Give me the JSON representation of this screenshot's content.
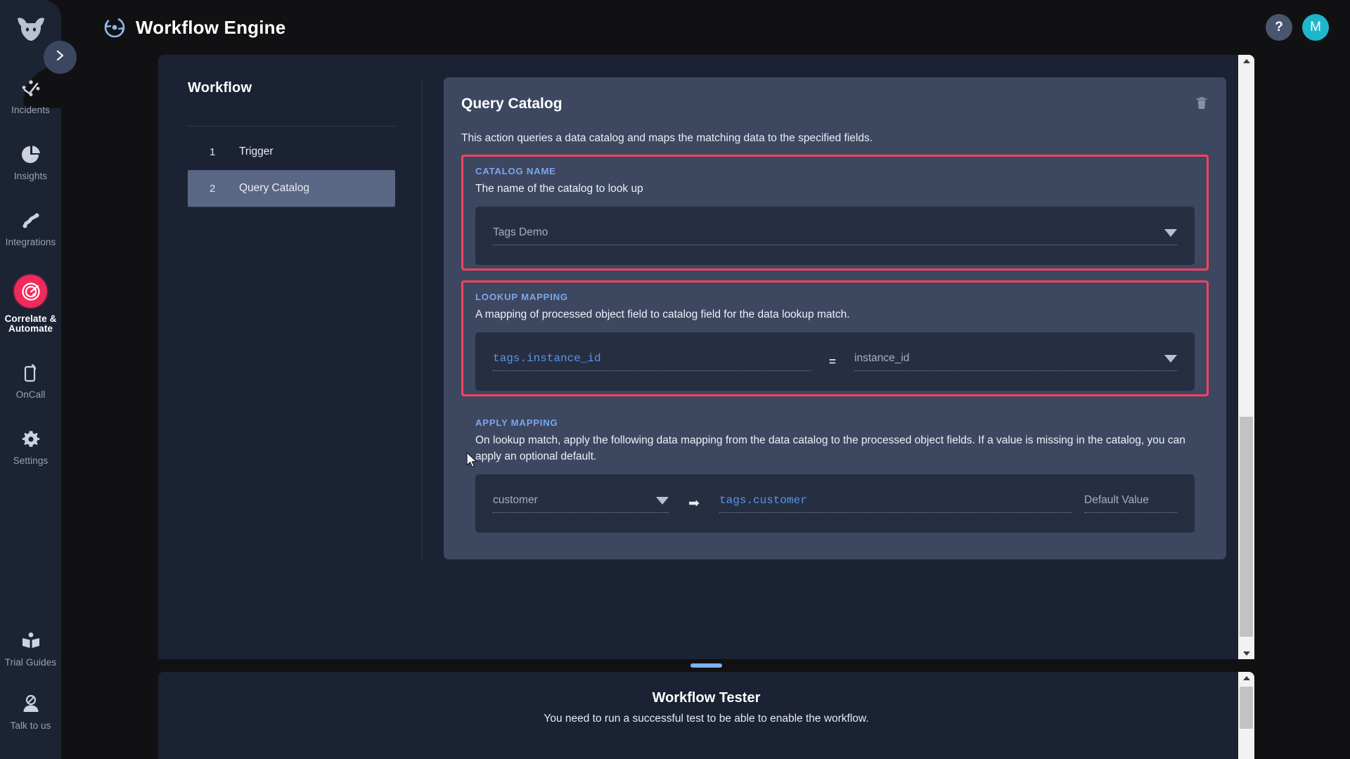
{
  "app": {
    "title": "Workflow Engine",
    "title_icon": "workflow-sync-icon",
    "logo_icon": "bull-head-logo",
    "collapse_icon": "chevron-right-icon",
    "help_label": "?",
    "avatar_label": "M"
  },
  "sidebar": {
    "items": [
      {
        "label": "Incidents",
        "icon": "incidents-nodes-icon",
        "active": false
      },
      {
        "label": "Insights",
        "icon": "pie-chart-icon",
        "active": false
      },
      {
        "label": "Integrations",
        "icon": "integrations-link-icon",
        "active": false
      },
      {
        "label": "Correlate & Automate",
        "icon": "target-radar-icon",
        "active": true
      },
      {
        "label": "OnCall",
        "icon": "mobile-phone-icon",
        "active": false
      },
      {
        "label": "Settings",
        "icon": "gear-icon",
        "active": false
      }
    ],
    "bottom_items": [
      {
        "label": "Trial Guides",
        "icon": "open-book-icon"
      },
      {
        "label": "Talk to us",
        "icon": "support-person-icon"
      }
    ]
  },
  "workflow_panel": {
    "title": "Workflow",
    "steps": [
      {
        "number": "1",
        "name": "Trigger",
        "selected": false
      },
      {
        "number": "2",
        "name": "Query Catalog",
        "selected": true
      }
    ]
  },
  "action_card": {
    "title": "Query Catalog",
    "description": "This action queries a data catalog and maps the matching data to the specified fields.",
    "delete_icon": "trash-icon",
    "fields": [
      {
        "key": "catalog_name",
        "label": "CATALOG NAME",
        "description": "The name of the catalog to look up",
        "highlighted": true,
        "value": "Tags Demo",
        "dropdown_icon": "chevron-down-icon"
      },
      {
        "key": "lookup_mapping",
        "label": "LOOKUP MAPPING",
        "description": "A mapping of processed object field to catalog field for the data lookup match.",
        "highlighted": true,
        "source_field": "tags.instance_id",
        "operator": "=",
        "target_field": "instance_id",
        "dropdown_icon": "chevron-down-icon"
      },
      {
        "key": "apply_mapping",
        "label": "APPLY MAPPING",
        "description": "On lookup match, apply the following data mapping from the data catalog to the processed object fields. If a value is missing in the catalog, you can apply an optional default.",
        "highlighted": false,
        "source_field": "customer",
        "arrow": "➡",
        "target_field": "tags.customer",
        "default_placeholder": "Default Value",
        "dropdown_icon": "chevron-down-icon"
      }
    ]
  },
  "tester": {
    "title": "Workflow Tester",
    "message": "You need to run a successful test to be able to enable the workflow.",
    "grabber": "resize-handle"
  },
  "colors": {
    "accent_pink": "#f2295b",
    "highlight_red": "#f8425f",
    "link_blue": "#7ba7e8",
    "code_blue": "#5b93e6",
    "avatar_teal": "#1fb6cc",
    "panel_bg": "#1b2233",
    "card_bg": "#3d4760",
    "input_bg": "#262f42",
    "rail_bg": "#1c2333",
    "page_bg": "#111113"
  }
}
